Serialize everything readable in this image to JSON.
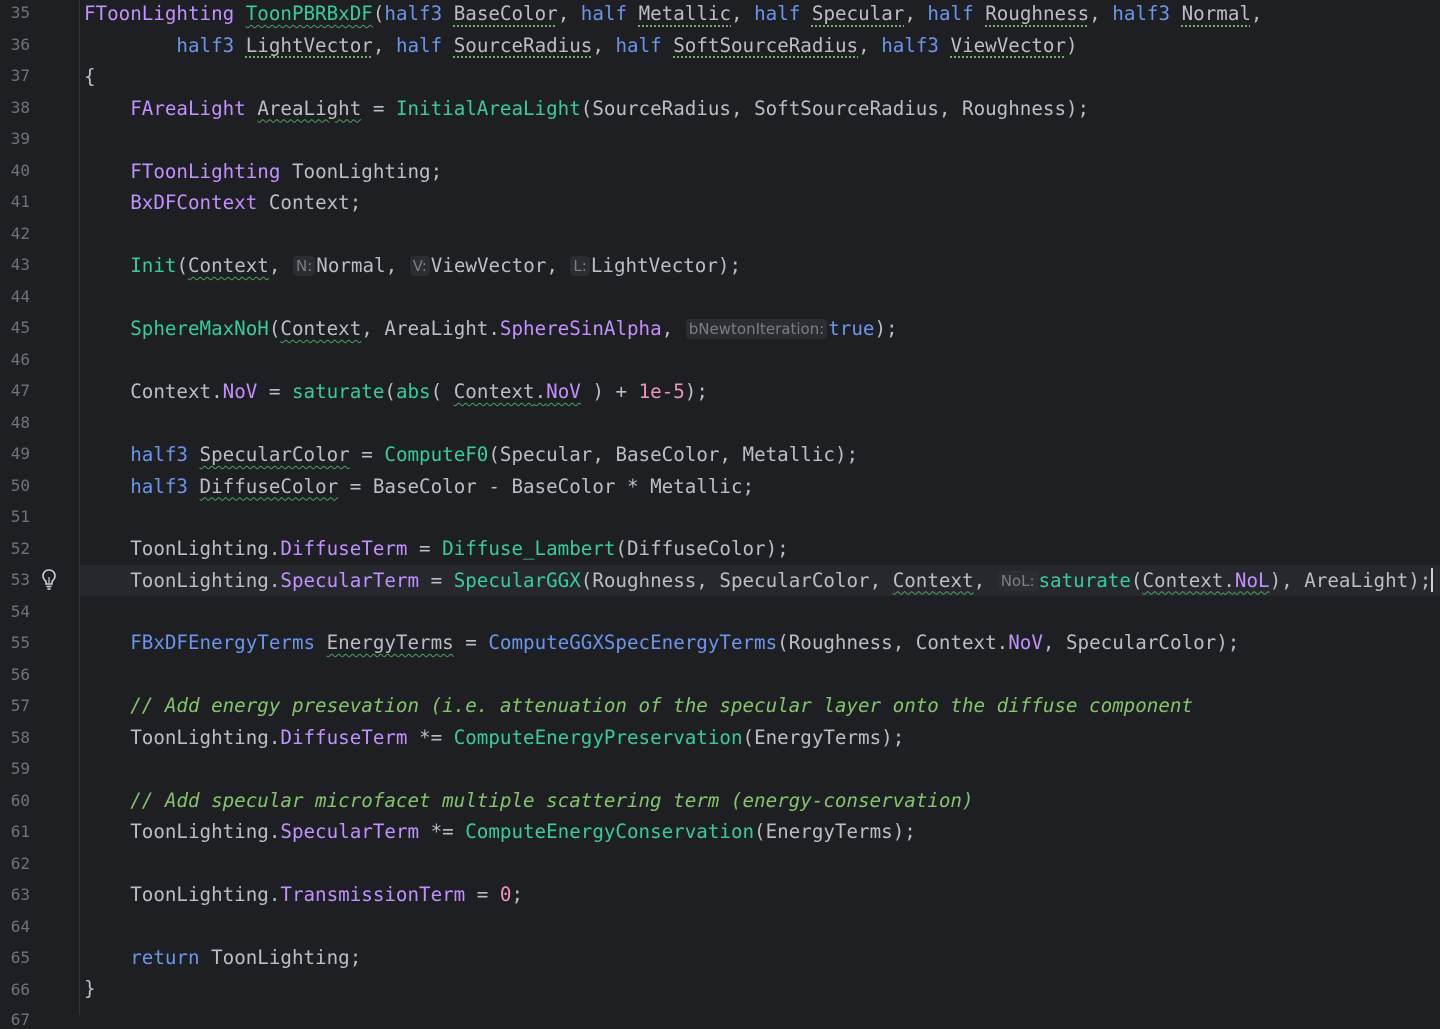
{
  "line_numbers": [
    "35",
    "36",
    "37",
    "38",
    "39",
    "40",
    "41",
    "42",
    "43",
    "44",
    "45",
    "46",
    "47",
    "48",
    "49",
    "50",
    "51",
    "52",
    "53",
    "54",
    "55",
    "56",
    "57",
    "58",
    "59",
    "60",
    "61",
    "62",
    "63",
    "64",
    "65",
    "66",
    "67"
  ],
  "tokens": {
    "FToonLighting": "FToonLighting",
    "ToonPBRBxDF": "ToonPBRBxDF",
    "half3": "half3",
    "half": "half",
    "BaseColor": "BaseColor",
    "Metallic": "Metallic",
    "Specular": "Specular",
    "Roughness": "Roughness",
    "Normal": "Normal",
    "LightVector": "LightVector",
    "SourceRadius": "SourceRadius",
    "SoftSourceRadius": "SoftSourceRadius",
    "ViewVector": "ViewVector",
    "FAreaLight": "FAreaLight",
    "AreaLight": "AreaLight",
    "InitialAreaLight": "InitialAreaLight",
    "ToonLighting": "ToonLighting",
    "BxDFContext": "BxDFContext",
    "Context": "Context",
    "Init": "Init",
    "SphereMaxNoH": "SphereMaxNoH",
    "SphereSinAlpha": "SphereSinAlpha",
    "true": "true",
    "NoV": "NoV",
    "NoL": "NoL",
    "saturate": "saturate",
    "abs": "abs",
    "num_1e5": "1e-5",
    "SpecularColor": "SpecularColor",
    "ComputeF0": "ComputeF0",
    "DiffuseColor": "DiffuseColor",
    "DiffuseTerm": "DiffuseTerm",
    "Diffuse_Lambert": "Diffuse_Lambert",
    "SpecularTerm": "SpecularTerm",
    "SpecularGGX": "SpecularGGX",
    "FBxDFEnergyTerms": "FBxDFEnergyTerms",
    "EnergyTerms": "EnergyTerms",
    "ComputeGGXSpecEnergyTerms": "ComputeGGXSpecEnergyTerms",
    "comment1": "// Add energy presevation (i.e. attenuation of the specular layer onto the diffuse component",
    "ComputeEnergyPreservation": "ComputeEnergyPreservation",
    "comment2": "// Add specular microfacet multiple scattering term (energy-conservation)",
    "ComputeEnergyConservation": "ComputeEnergyConservation",
    "TransmissionTerm": "TransmissionTerm",
    "num_0": "0",
    "return": "return"
  },
  "hints": {
    "N": "N:",
    "V": "V:",
    "L": "L:",
    "bNewtonIteration": "bNewtonIteration:",
    "NoL": "NoL:"
  },
  "icons": {
    "gutter_bulb": "lightbulb-icon"
  },
  "colors": {
    "background": "#1e1f22",
    "keyword": "#6c95eb",
    "type": "#c191ff",
    "function": "#39cc9b",
    "number": "#ed94c0",
    "comment": "#85c46c",
    "text": "#bcbec4"
  }
}
